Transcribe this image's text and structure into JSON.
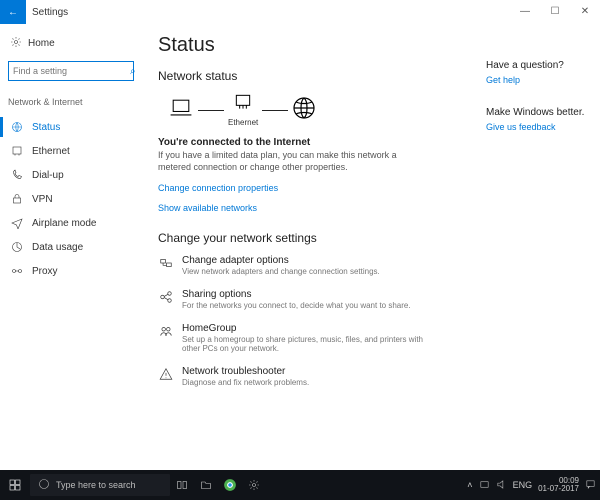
{
  "titlebar": {
    "title": "Settings",
    "back": "←",
    "min": "—",
    "max": "☐",
    "close": "✕"
  },
  "sidebar": {
    "home": "Home",
    "search_placeholder": "Find a setting",
    "section": "Network & Internet",
    "items": [
      {
        "label": "Status"
      },
      {
        "label": "Ethernet"
      },
      {
        "label": "Dial-up"
      },
      {
        "label": "VPN"
      },
      {
        "label": "Airplane mode"
      },
      {
        "label": "Data usage"
      },
      {
        "label": "Proxy"
      }
    ]
  },
  "main": {
    "heading": "Status",
    "subheading": "Network status",
    "diag_label": "Ethernet",
    "connected_title": "You're connected to the Internet",
    "connected_desc": "If you have a limited data plan, you can make this network a metered connection or change other properties.",
    "link_props": "Change connection properties",
    "link_avail": "Show available networks",
    "change_heading": "Change your network settings",
    "options": [
      {
        "title": "Change adapter options",
        "desc": "View network adapters and change connection settings."
      },
      {
        "title": "Sharing options",
        "desc": "For the networks you connect to, decide what you want to share."
      },
      {
        "title": "HomeGroup",
        "desc": "Set up a homegroup to share pictures, music, files, and printers with other PCs on your network."
      },
      {
        "title": "Network troubleshooter",
        "desc": "Diagnose and fix network problems."
      }
    ]
  },
  "right": {
    "q1": "Have a question?",
    "link1": "Get help",
    "q2": "Make Windows better.",
    "link2": "Give us feedback"
  },
  "taskbar": {
    "search": "Type here to search",
    "lang": "ENG",
    "time": "00:09",
    "date": "01-07-2017"
  }
}
